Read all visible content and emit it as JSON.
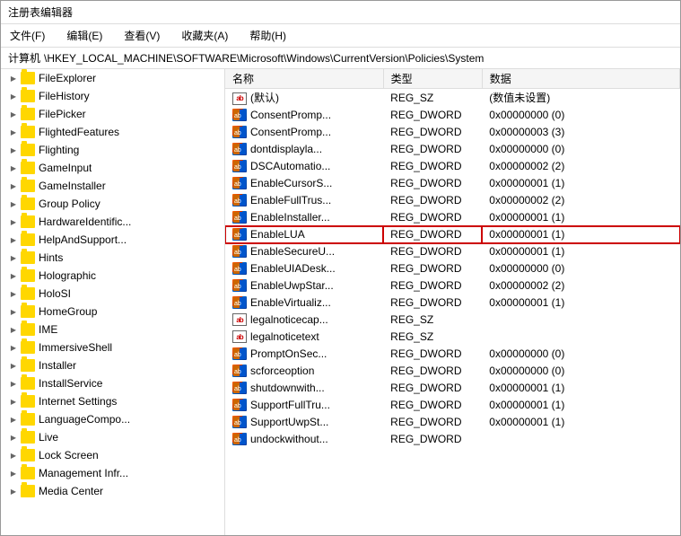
{
  "window": {
    "title": "注册表编辑器",
    "menu": [
      "文件(F)",
      "编辑(E)",
      "查看(V)",
      "收藏夹(A)",
      "帮助(H)"
    ],
    "address_label": "计算机",
    "address_path": "\\HKEY_LOCAL_MACHINE\\SOFTWARE\\Microsoft\\Windows\\CurrentVersion\\Policies\\System"
  },
  "tree": {
    "items": [
      {
        "label": "FileExplorer",
        "arrow": "collapsed",
        "indent": 1
      },
      {
        "label": "FileHistory",
        "arrow": "collapsed",
        "indent": 1
      },
      {
        "label": "FilePicker",
        "arrow": "collapsed",
        "indent": 1
      },
      {
        "label": "FlightedFeatures",
        "arrow": "collapsed",
        "indent": 1
      },
      {
        "label": "Flighting",
        "arrow": "collapsed",
        "indent": 1
      },
      {
        "label": "GameInput",
        "arrow": "collapsed",
        "indent": 1
      },
      {
        "label": "GameInstaller",
        "arrow": "collapsed",
        "indent": 1
      },
      {
        "label": "Group Policy",
        "arrow": "collapsed",
        "indent": 1
      },
      {
        "label": "HardwareIdentific...",
        "arrow": "collapsed",
        "indent": 1
      },
      {
        "label": "HelpAndSupport...",
        "arrow": "collapsed",
        "indent": 1
      },
      {
        "label": "Hints",
        "arrow": "collapsed",
        "indent": 1
      },
      {
        "label": "Holographic",
        "arrow": "collapsed",
        "indent": 1
      },
      {
        "label": "HoloSI",
        "arrow": "collapsed",
        "indent": 1
      },
      {
        "label": "HomeGroup",
        "arrow": "collapsed",
        "indent": 1
      },
      {
        "label": "IME",
        "arrow": "collapsed",
        "indent": 1
      },
      {
        "label": "ImmersiveShell",
        "arrow": "collapsed",
        "indent": 1
      },
      {
        "label": "Installer",
        "arrow": "collapsed",
        "indent": 1
      },
      {
        "label": "InstallService",
        "arrow": "collapsed",
        "indent": 1
      },
      {
        "label": "Internet Settings",
        "arrow": "collapsed",
        "indent": 1
      },
      {
        "label": "LanguageCompo...",
        "arrow": "collapsed",
        "indent": 1
      },
      {
        "label": "Live",
        "arrow": "collapsed",
        "indent": 1
      },
      {
        "label": "Lock Screen",
        "arrow": "collapsed",
        "indent": 1
      },
      {
        "label": "Management Infr...",
        "arrow": "collapsed",
        "indent": 1
      },
      {
        "label": "Media Center",
        "arrow": "collapsed",
        "indent": 1
      }
    ]
  },
  "registry": {
    "columns": [
      "名称",
      "类型",
      "数据"
    ],
    "rows": [
      {
        "name": "(默认)",
        "type": "REG_SZ",
        "data": "(数值未设置)",
        "icon": "ab",
        "highlighted": false
      },
      {
        "name": "ConsentPromp...",
        "type": "REG_DWORD",
        "data": "0x00000000 (0)",
        "icon": "dword",
        "highlighted": false
      },
      {
        "name": "ConsentPromp...",
        "type": "REG_DWORD",
        "data": "0x00000003 (3)",
        "icon": "dword",
        "highlighted": false
      },
      {
        "name": "dontdisplayla...",
        "type": "REG_DWORD",
        "data": "0x00000000 (0)",
        "icon": "dword",
        "highlighted": false
      },
      {
        "name": "DSCAutomatio...",
        "type": "REG_DWORD",
        "data": "0x00000002 (2)",
        "icon": "dword",
        "highlighted": false
      },
      {
        "name": "EnableCursorS...",
        "type": "REG_DWORD",
        "data": "0x00000001 (1)",
        "icon": "dword",
        "highlighted": false
      },
      {
        "name": "EnableFullTrus...",
        "type": "REG_DWORD",
        "data": "0x00000002 (2)",
        "icon": "dword",
        "highlighted": false
      },
      {
        "name": "EnableInstaller...",
        "type": "REG_DWORD",
        "data": "0x00000001 (1)",
        "icon": "dword",
        "highlighted": false
      },
      {
        "name": "EnableLUA",
        "type": "REG_DWORD",
        "data": "0x00000001 (1)",
        "icon": "dword",
        "highlighted": true
      },
      {
        "name": "EnableSecureU...",
        "type": "REG_DWORD",
        "data": "0x00000001 (1)",
        "icon": "dword",
        "highlighted": false
      },
      {
        "name": "EnableUIADesk...",
        "type": "REG_DWORD",
        "data": "0x00000000 (0)",
        "icon": "dword",
        "highlighted": false
      },
      {
        "name": "EnableUwpStar...",
        "type": "REG_DWORD",
        "data": "0x00000002 (2)",
        "icon": "dword",
        "highlighted": false
      },
      {
        "name": "EnableVirtualiz...",
        "type": "REG_DWORD",
        "data": "0x00000001 (1)",
        "icon": "dword",
        "highlighted": false
      },
      {
        "name": "legalnoticecap...",
        "type": "REG_SZ",
        "data": "",
        "icon": "ab",
        "highlighted": false
      },
      {
        "name": "legalnoticetext",
        "type": "REG_SZ",
        "data": "",
        "icon": "ab",
        "highlighted": false
      },
      {
        "name": "PromptOnSec...",
        "type": "REG_DWORD",
        "data": "0x00000000 (0)",
        "icon": "dword",
        "highlighted": false
      },
      {
        "name": "scforceoption",
        "type": "REG_DWORD",
        "data": "0x00000000 (0)",
        "icon": "dword",
        "highlighted": false
      },
      {
        "name": "shutdownwith...",
        "type": "REG_DWORD",
        "data": "0x00000001 (1)",
        "icon": "dword",
        "highlighted": false
      },
      {
        "name": "SupportFullTru...",
        "type": "REG_DWORD",
        "data": "0x00000001 (1)",
        "icon": "dword",
        "highlighted": false
      },
      {
        "name": "SupportUwpSt...",
        "type": "REG_DWORD",
        "data": "0x00000001 (1)",
        "icon": "dword",
        "highlighted": false
      },
      {
        "name": "undockwithout...",
        "type": "REG_DWORD",
        "data": "",
        "icon": "dword",
        "highlighted": false
      }
    ]
  }
}
